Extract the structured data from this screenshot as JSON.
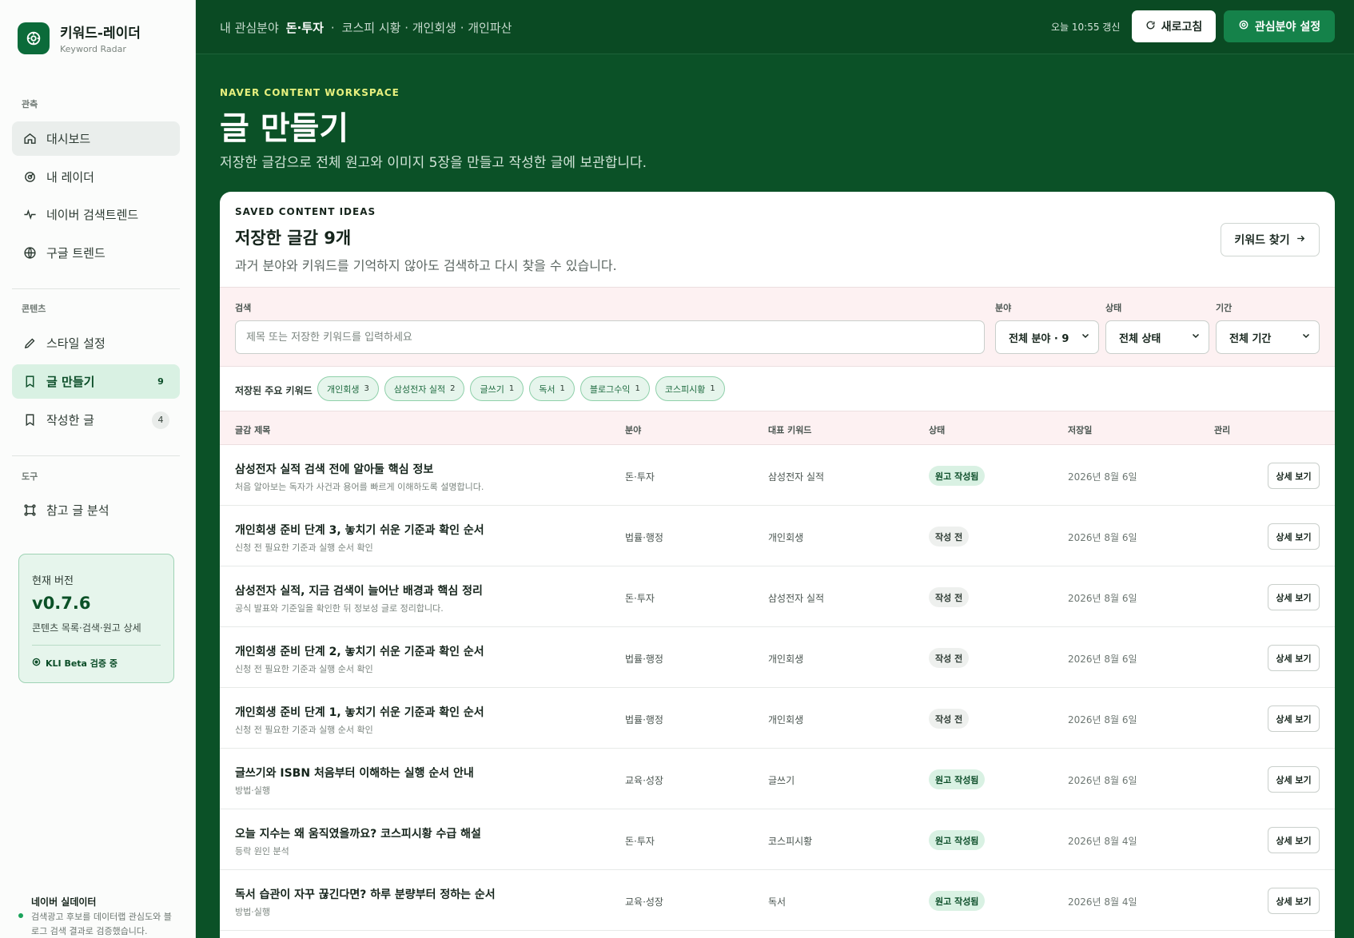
{
  "app": {
    "name": "키워드-레이더",
    "subtitle": "Keyword Radar"
  },
  "sidebar": {
    "sections": [
      {
        "label": "관측",
        "items": [
          {
            "label": "대시보드",
            "icon": "home-icon"
          },
          {
            "label": "내 레이더",
            "icon": "radar-icon"
          },
          {
            "label": "네이버 검색트렌드",
            "icon": "pulse-icon"
          },
          {
            "label": "구글 트렌드",
            "icon": "globe-icon"
          }
        ]
      },
      {
        "label": "콘텐츠",
        "items": [
          {
            "label": "스타일 설정",
            "icon": "pen-icon"
          },
          {
            "label": "글 만들기",
            "icon": "bookmark-icon",
            "count": "9"
          },
          {
            "label": "작성한 글",
            "icon": "bookmark-icon",
            "count": "4"
          }
        ]
      },
      {
        "label": "도구",
        "items": [
          {
            "label": "참고 글 분석",
            "icon": "frame-icon"
          }
        ]
      }
    ],
    "version": {
      "label": "현재 버전",
      "number": "v0.7.6",
      "desc": "콘텐츠 목록·검색·원고 상세",
      "status": "KLI Beta 검증 중"
    },
    "footer": {
      "title": "네이버 실데이터",
      "desc": "검색광고 후보를 데이터랩 관심도와 블로그 검색 결과로 검증했습니다."
    }
  },
  "topbar": {
    "crumb_prefix": "내 관심분야",
    "crumb_active": "돈·투자",
    "crumb_sep": "·",
    "crumb_rest": "코스피 시황 · 개인회생 · 개인파산",
    "updated": "오늘 10:55 갱신",
    "refresh_label": "새로고침",
    "interest_label": "관심분야 설정"
  },
  "hero": {
    "eyebrow": "NAVER CONTENT WORKSPACE",
    "title": "글 만들기",
    "subtitle": "저장한 글감으로 전체 원고와 이미지 5장을 만들고 작성한 글에 보관합니다."
  },
  "card": {
    "eyebrow": "SAVED CONTENT IDEAS",
    "title": "저장한 글감 9개",
    "subtitle": "과거 분야와 키워드를 기억하지 않아도 검색하고 다시 찾을 수 있습니다.",
    "find_keyword": "키워드 찾기",
    "filters": {
      "search_label": "검색",
      "search_placeholder": "제목 또는 저장한 키워드를 입력하세요",
      "category_label": "분야",
      "category_value": "전체 분야 · 9",
      "status_label": "상태",
      "status_value": "전체 상태",
      "period_label": "기간",
      "period_value": "전체 기간"
    },
    "keywords_label": "저장된 주요 키워드",
    "keywords": [
      {
        "name": "개인회생",
        "count": "3"
      },
      {
        "name": "삼성전자 실적",
        "count": "2"
      },
      {
        "name": "글쓰기",
        "count": "1"
      },
      {
        "name": "독서",
        "count": "1"
      },
      {
        "name": "블로그수익",
        "count": "1"
      },
      {
        "name": "코스피시황",
        "count": "1"
      }
    ],
    "columns": {
      "title": "글감 제목",
      "category": "분야",
      "keyword": "대표 키워드",
      "status": "상태",
      "date": "저장일",
      "manage": "관리"
    },
    "rows": [
      {
        "title": "삼성전자 실적 검색 전에 알아둘 핵심 정보",
        "desc": "처음 알아보는 독자가 사건과 용어를 빠르게 이해하도록 설명합니다.",
        "category": "돈·투자",
        "keyword": "삼성전자 실적",
        "status": "원고 작성됨",
        "done": true,
        "date": "2026년 8월 6일",
        "action": "상세 보기"
      },
      {
        "title": "개인회생 준비 단계 3, 놓치기 쉬운 기준과 확인 순서",
        "desc": "신청 전 필요한 기준과 실행 순서 확인",
        "category": "법률·행정",
        "keyword": "개인회생",
        "status": "작성 전",
        "done": false,
        "date": "2026년 8월 6일",
        "action": "상세 보기"
      },
      {
        "title": "삼성전자 실적, 지금 검색이 늘어난 배경과 핵심 정리",
        "desc": "공식 발표와 기준일을 확인한 뒤 정보성 글로 정리합니다.",
        "category": "돈·투자",
        "keyword": "삼성전자 실적",
        "status": "작성 전",
        "done": false,
        "date": "2026년 8월 6일",
        "action": "상세 보기"
      },
      {
        "title": "개인회생 준비 단계 2, 놓치기 쉬운 기준과 확인 순서",
        "desc": "신청 전 필요한 기준과 실행 순서 확인",
        "category": "법률·행정",
        "keyword": "개인회생",
        "status": "작성 전",
        "done": false,
        "date": "2026년 8월 6일",
        "action": "상세 보기"
      },
      {
        "title": "개인회생 준비 단계 1, 놓치기 쉬운 기준과 확인 순서",
        "desc": "신청 전 필요한 기준과 실행 순서 확인",
        "category": "법률·행정",
        "keyword": "개인회생",
        "status": "작성 전",
        "done": false,
        "date": "2026년 8월 6일",
        "action": "상세 보기"
      },
      {
        "title": "글쓰기와 ISBN 처음부터 이해하는 실행 순서 안내",
        "desc": "방법·실행",
        "category": "교육·성장",
        "keyword": "글쓰기",
        "status": "원고 작성됨",
        "done": true,
        "date": "2026년 8월 6일",
        "action": "상세 보기"
      },
      {
        "title": "오늘 지수는 왜 움직였을까요? 코스피시황 수급 해설",
        "desc": "등락 원인 분석",
        "category": "돈·투자",
        "keyword": "코스피시황",
        "status": "원고 작성됨",
        "done": true,
        "date": "2026년 8월 4일",
        "action": "상세 보기"
      },
      {
        "title": "독서 습관이 자꾸 끊긴다면? 하루 분량부터 정하는 순서",
        "desc": "방법·실행",
        "category": "교육·성장",
        "keyword": "독서",
        "status": "원고 작성됨",
        "done": true,
        "date": "2026년 8월 4일",
        "action": "상세 보기"
      }
    ]
  }
}
